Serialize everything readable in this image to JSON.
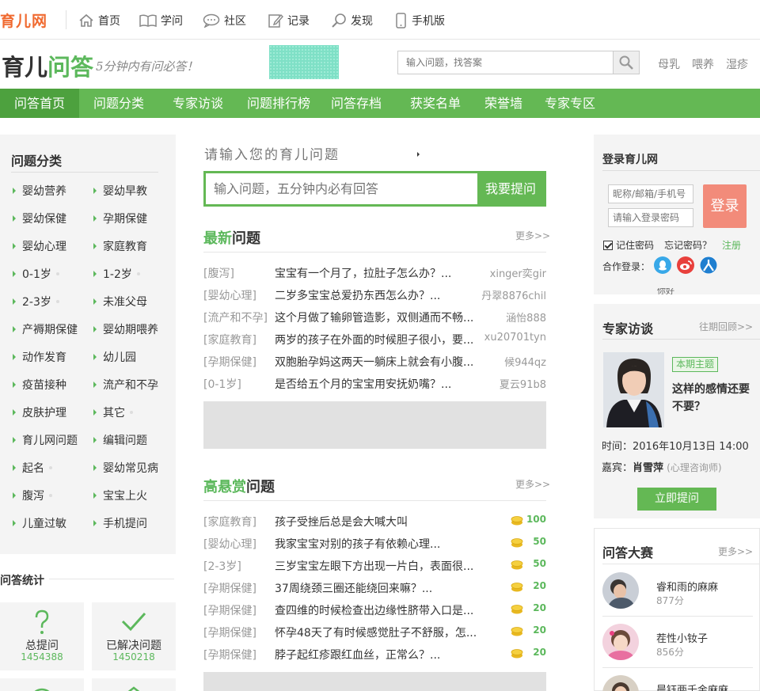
{
  "topnav": {
    "logo": "育儿网",
    "items": [
      {
        "label": "首页",
        "icon": "home-icon"
      },
      {
        "label": "学问",
        "icon": "book-icon"
      },
      {
        "label": "社区",
        "icon": "chat-icon"
      },
      {
        "label": "记录",
        "icon": "edit-icon"
      },
      {
        "label": "发现",
        "icon": "search-icon"
      },
      {
        "label": "手机版",
        "icon": "phone-icon"
      }
    ]
  },
  "header": {
    "title_black": "育儿",
    "title_green": "问答",
    "slogan": "5分钟内有问必答！",
    "search_placeholder": "输入问题，找答案",
    "hot": [
      "母乳",
      "喂养",
      "湿疹"
    ]
  },
  "menu": [
    "问答首页",
    "问题分类",
    "专家访谈",
    "问题排行榜",
    "问答存档",
    "获奖名单",
    "荣誉墙",
    "专家专区"
  ],
  "categories": {
    "title": "问题分类",
    "items": [
      "婴幼营养",
      "婴幼早教",
      "婴幼保健",
      "孕期保健",
      "婴幼心理",
      "家庭教育",
      "0-1岁",
      "1-2岁",
      "2-3岁",
      "未准父母",
      "产褥期保健",
      "婴幼期喂养",
      "动作发育",
      "幼儿园",
      "疫苗接种",
      "流产和不孕",
      "皮肤护理",
      "其它",
      "育儿网问题",
      "编辑问题",
      "起名",
      "婴幼常见病",
      "腹泻",
      "宝宝上火",
      "儿童过敏",
      "手机提问"
    ]
  },
  "stats": {
    "title": "问答统计",
    "total_label": "总提问",
    "total_value": "1454388",
    "solved_label": "已解决问题",
    "solved_value": "1450218"
  },
  "ask": {
    "hint": "请输入您的育儿问题",
    "placeholder": "输入问题，五分钟内必有回答",
    "button": "我要提问"
  },
  "latest": {
    "title_green": "最新",
    "title_black": "问题",
    "more": "更多>>",
    "rows": [
      {
        "tag": "[腹泻]",
        "q": "宝宝有一个月了，拉肚子怎么办？...",
        "user": "xinger奕gir"
      },
      {
        "tag": "[婴幼心理]",
        "q": "二岁多宝宝总爱扔东西怎么办？...",
        "user": "丹翠8876chil"
      },
      {
        "tag": "[流产和不孕]",
        "q": "这个月做了输卵管造影，双侧通而不畅...",
        "user": "涵怡888"
      },
      {
        "tag": "[家庭教育]",
        "q": "两岁的孩子在外面的时候胆子很小，要...",
        "user": "xu20701tyn"
      },
      {
        "tag": "[孕期保健]",
        "q": "双胞胎孕妈这两天一躺床上就会有小腹...",
        "user": "候944qz"
      },
      {
        "tag": "[0-1岁]",
        "q": "是否给五个月的宝宝用安抚奶嘴？...",
        "user": "夏云91b8"
      }
    ]
  },
  "reward": {
    "title_green": "高悬赏",
    "title_black": "问题",
    "more": "更多>>",
    "rows": [
      {
        "tag": "[家庭教育]",
        "q": "孩子受挫后总是会大喊大叫",
        "pts": "100"
      },
      {
        "tag": "[婴幼心理]",
        "q": "我家宝宝对别的孩子有依赖心理...",
        "pts": "50"
      },
      {
        "tag": "[2-3岁]",
        "q": "三岁宝宝左眼下方出现一片白，表面很...",
        "pts": "50"
      },
      {
        "tag": "[孕期保健]",
        "q": "37周绕颈三圈还能绕回来嘛？...",
        "pts": "20"
      },
      {
        "tag": "[孕期保健]",
        "q": "查四维的时候检查出边缘性脐带入口是...",
        "pts": "20"
      },
      {
        "tag": "[孕期保健]",
        "q": "怀孕48天了有时候感觉肚子不舒服，怎...",
        "pts": "20"
      },
      {
        "tag": "[孕期保健]",
        "q": "脖子起红疹跟红血丝，正常么？...",
        "pts": "20"
      }
    ]
  },
  "login": {
    "title": "登录育儿网",
    "user_placeholder": "昵称/邮箱/手机号",
    "pass_placeholder": "请输入登录密码",
    "button": "登录",
    "remember": "记住密码",
    "forgot": "忘记密码？",
    "register": "注册",
    "coop": "合作登录：",
    "cut_text": "你好"
  },
  "expert": {
    "title": "专家访谈",
    "more": "往期回顾>>",
    "badge": "本期主题",
    "topic": "这样的感情还要不要？",
    "time": "时间：2016年10月13日   14:00",
    "guest_prefix": "嘉宾：",
    "guest_name": "肖雪萍",
    "guest_role": "(心理咨询师)",
    "button": "立即提问"
  },
  "contest": {
    "title": "问答大赛",
    "more": "更多>>",
    "rows": [
      {
        "name": "睿和雨的麻麻",
        "score": "877分"
      },
      {
        "name": "茬性小钕子",
        "score": "856分"
      },
      {
        "name": "晨钰两千金麻麻",
        "score": ""
      }
    ]
  },
  "colors": {
    "green": "#64b854",
    "accent_green": "#5cb85c",
    "orange": "#f06a30",
    "login_button": "#f28b7a"
  }
}
